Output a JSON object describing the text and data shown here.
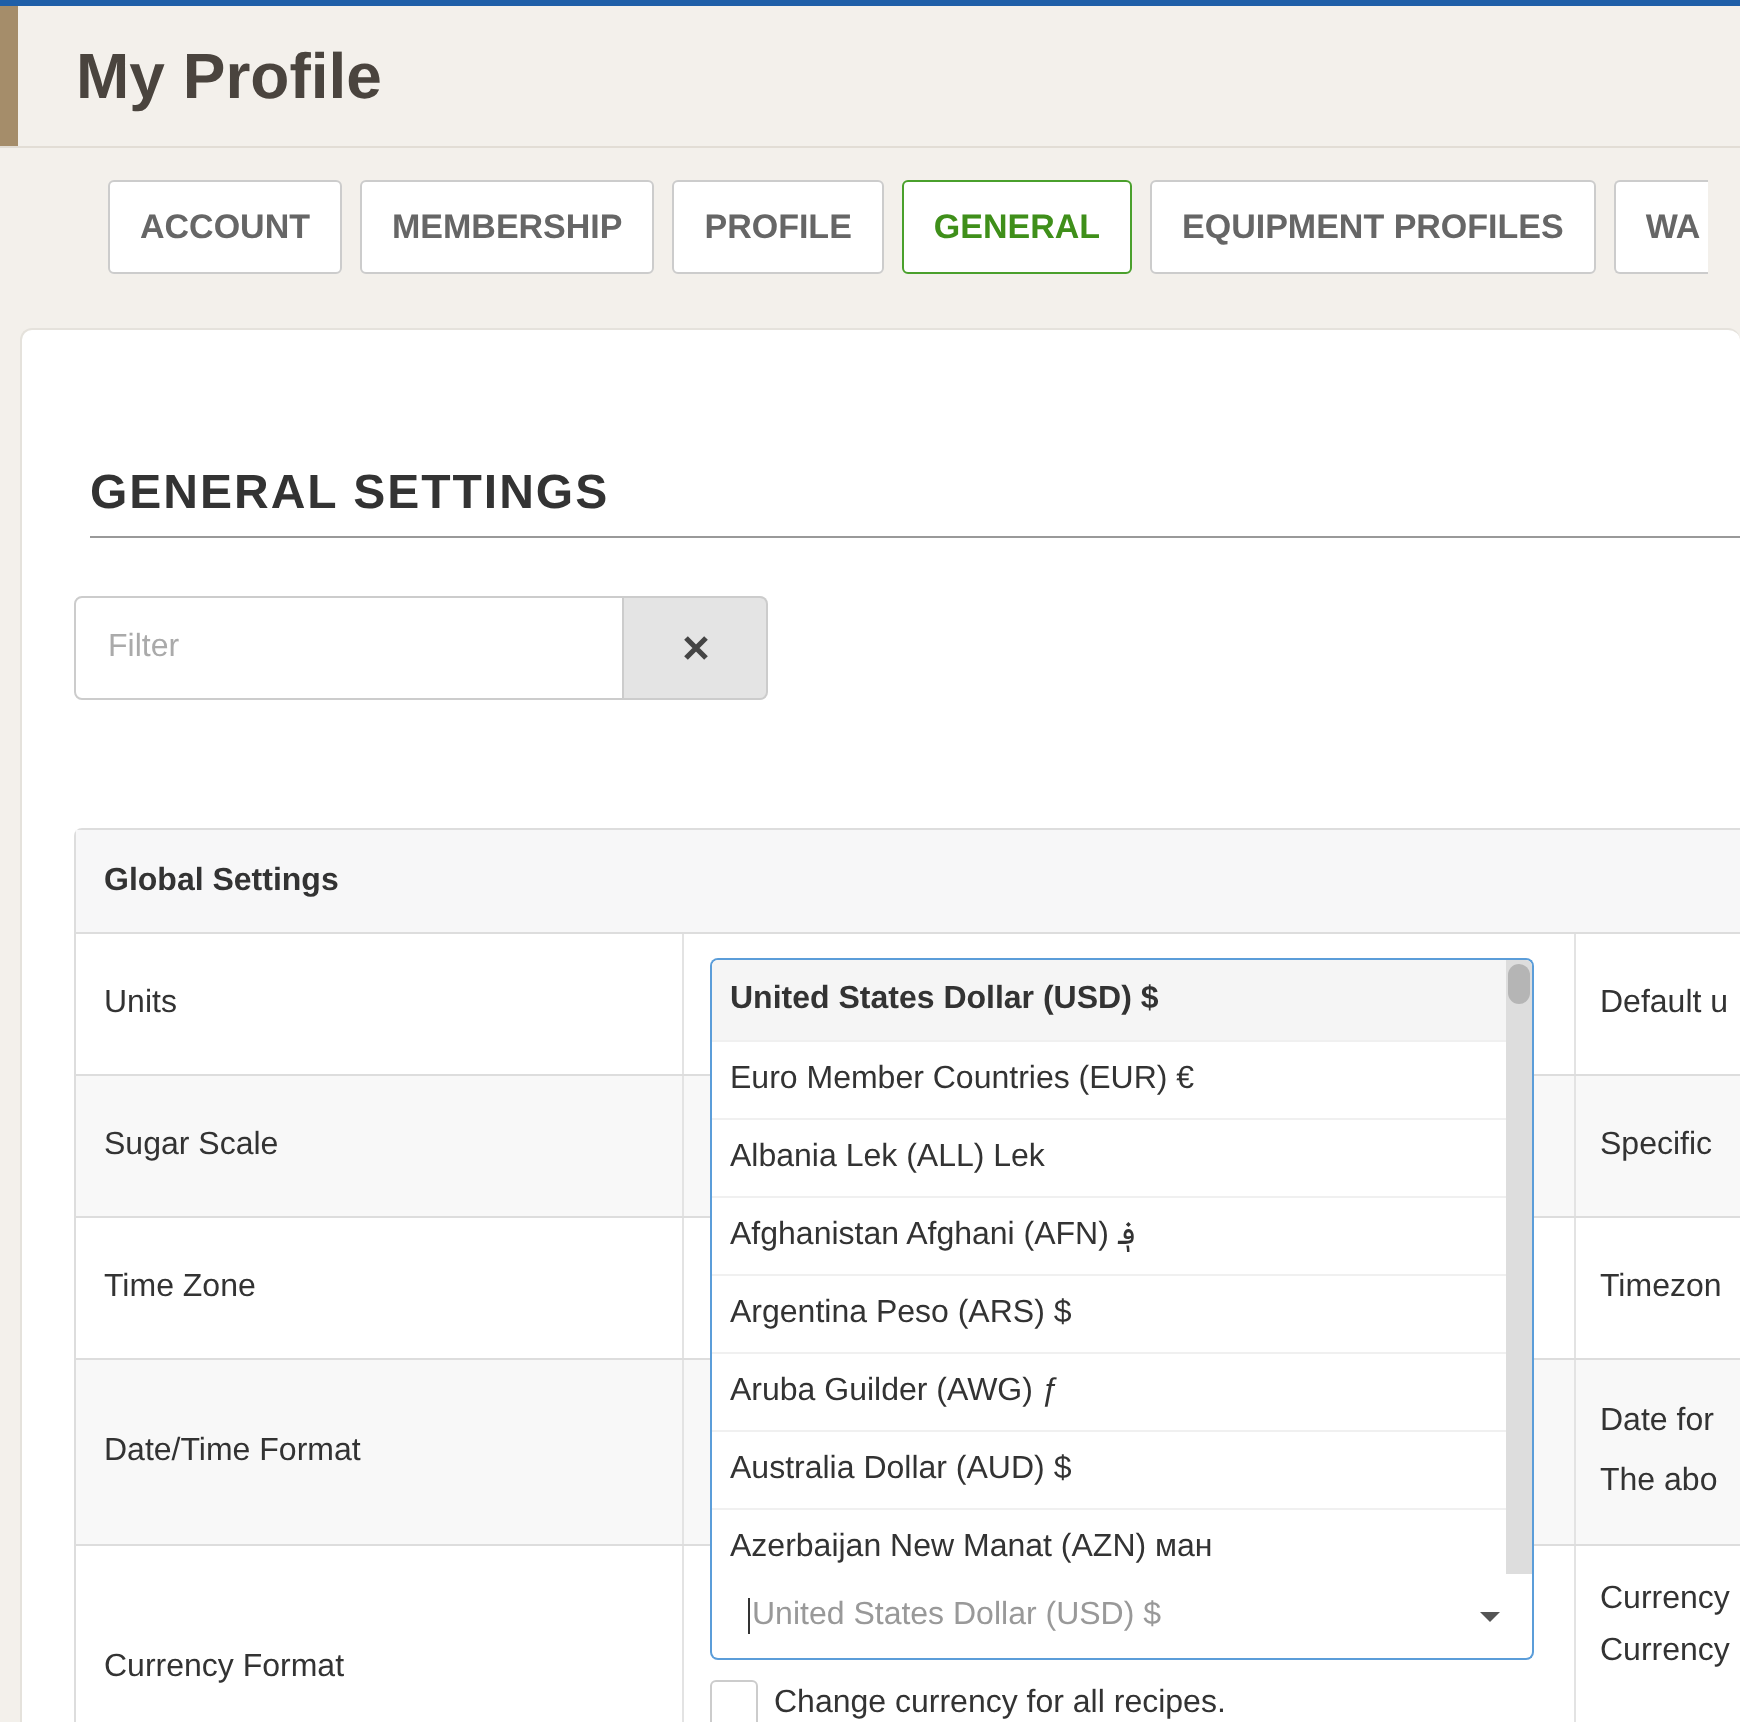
{
  "header": {
    "title": "My Profile"
  },
  "tabs": [
    {
      "label": "ACCOUNT",
      "selected": false
    },
    {
      "label": "MEMBERSHIP",
      "selected": false
    },
    {
      "label": "PROFILE",
      "selected": false
    },
    {
      "label": "GENERAL",
      "selected": true
    },
    {
      "label": "EQUIPMENT PROFILES",
      "selected": false
    },
    {
      "label": "WA",
      "selected": false
    }
  ],
  "section": {
    "title": "GENERAL SETTINGS"
  },
  "filter": {
    "placeholder": "Filter"
  },
  "table": {
    "title": "Global Settings",
    "rows": [
      {
        "label": "Units",
        "description": [
          "Default u"
        ]
      },
      {
        "label": "Sugar Scale",
        "description": [
          "Specific"
        ]
      },
      {
        "label": "Time Zone",
        "description": [
          "Timezon"
        ]
      },
      {
        "label": "Date/Time Format",
        "description": [
          "Date for",
          "The abo"
        ]
      },
      {
        "label": "Currency Format",
        "description": [
          "Currency",
          "Currency"
        ]
      }
    ]
  },
  "currency": {
    "placeholder": "United States Dollar (USD) $",
    "options": [
      {
        "label": "United States Dollar (USD) $",
        "selected": true
      },
      {
        "label": "Euro Member Countries (EUR) €",
        "selected": false
      },
      {
        "label": "Albania Lek (ALL) Lek",
        "selected": false
      },
      {
        "label": "Afghanistan Afghani (AFN) ؋",
        "selected": false
      },
      {
        "label": "Argentina Peso (ARS) $",
        "selected": false
      },
      {
        "label": "Aruba Guilder (AWG) ƒ",
        "selected": false
      },
      {
        "label": "Australia Dollar (AUD) $",
        "selected": false
      },
      {
        "label": "Azerbaijan New Manat (AZN) ман",
        "selected": false
      }
    ],
    "checkbox": {
      "label": "Change currency for all recipes.",
      "checked": false
    }
  }
}
